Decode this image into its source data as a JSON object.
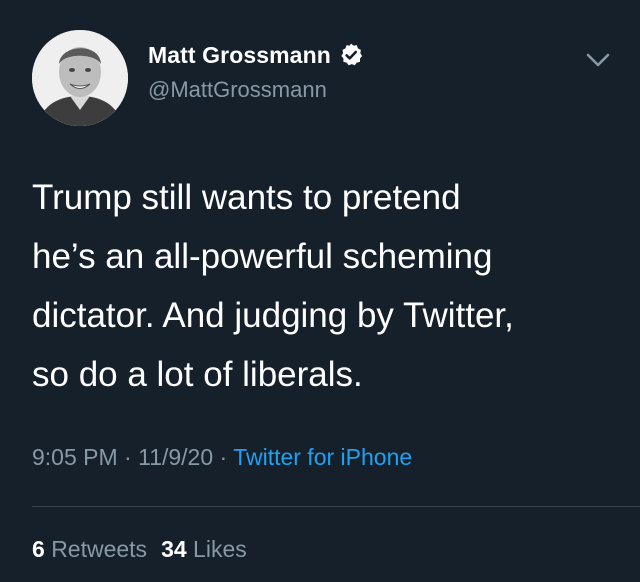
{
  "author": {
    "display_name": "Matt Grossmann",
    "handle": "@MattGrossmann",
    "verified": true
  },
  "tweet": {
    "lines": [
      "Trump still wants to pretend",
      "he’s an all-powerful scheming",
      "dictator. And judging by Twitter,",
      "so do a lot of liberals."
    ]
  },
  "meta": {
    "time": "9:05 PM",
    "separator": "·",
    "date": "11/9/20",
    "source": "Twitter for iPhone"
  },
  "stats": {
    "retweets_count": "6",
    "retweets_label": "Retweets",
    "likes_count": "34",
    "likes_label": "Likes"
  },
  "icons": {
    "verified": "verified-badge-icon",
    "menu": "chevron-down-icon"
  },
  "colors": {
    "background": "#15202b",
    "primary_text": "#ffffff",
    "secondary_text": "#8899a6",
    "link": "#1da1f2",
    "divider": "#38444d"
  }
}
